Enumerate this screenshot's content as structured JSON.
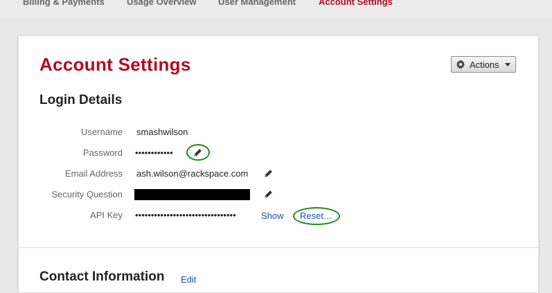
{
  "nav": {
    "tabs": [
      {
        "label": "Billing & Payments",
        "active": false
      },
      {
        "label": "Usage Overview",
        "active": false
      },
      {
        "label": "User Management",
        "active": false
      },
      {
        "label": "Account Settings",
        "active": true
      }
    ]
  },
  "page": {
    "title": "Account Settings",
    "actions_label": "Actions"
  },
  "login": {
    "title": "Login Details",
    "rows": [
      {
        "label": "Username",
        "value": "smashwilson"
      },
      {
        "label": "Password",
        "value": "••••••••••••"
      },
      {
        "label": "Email Address",
        "value": "ash.wilson@rackspace.com"
      },
      {
        "label": "Security Question",
        "value": ""
      },
      {
        "label": "API Key",
        "value": "••••••••••••••••••••••••••••••••"
      }
    ],
    "show_label": "Show",
    "reset_label": "Reset…"
  },
  "contact": {
    "title": "Contact Information",
    "edit_label": "Edit"
  },
  "colors": {
    "brand_red": "#b30a20",
    "link_blue": "#1a54a8",
    "annotation_green": "#1f8a1f"
  },
  "icons": [
    "gear-icon",
    "caret-down-icon",
    "pencil-icon"
  ]
}
